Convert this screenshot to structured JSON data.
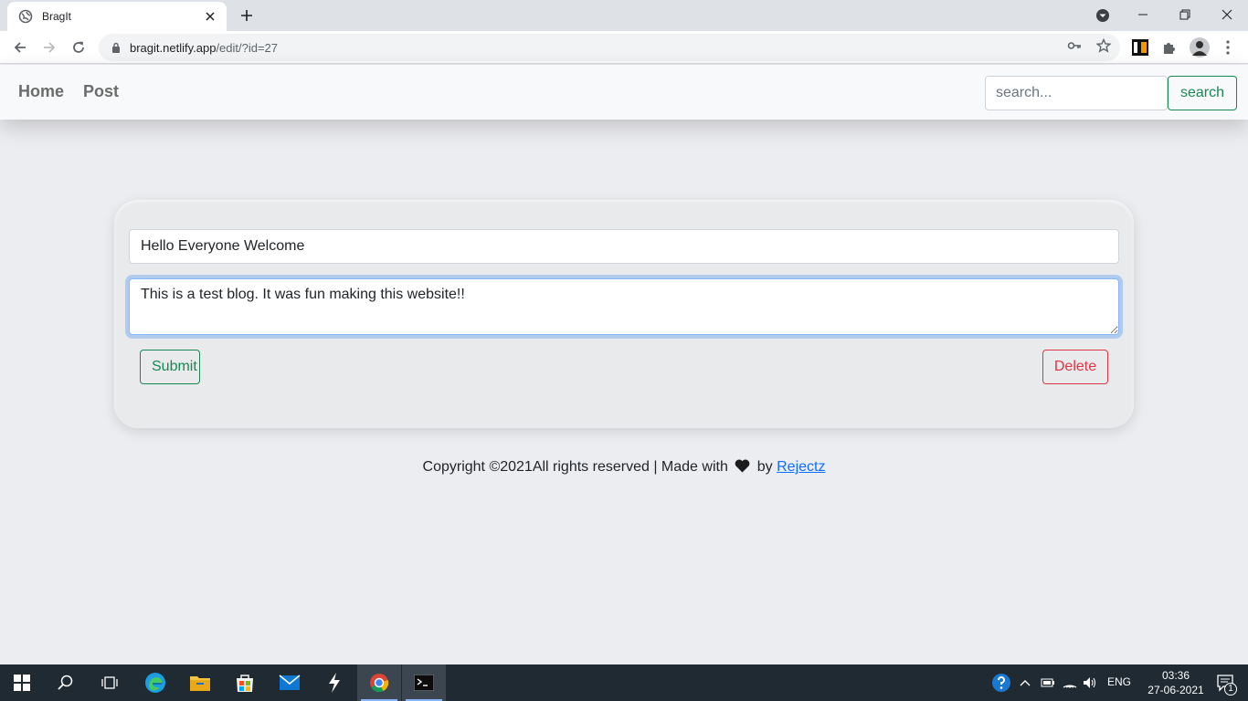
{
  "browser": {
    "tab_title": "BragIt",
    "url_host": "bragit.netlify.app",
    "url_path": "/edit/?id=27"
  },
  "navbar": {
    "home_label": "Home",
    "post_label": "Post",
    "search_placeholder": "search...",
    "search_button": "search"
  },
  "editor": {
    "title_value": "Hello Everyone Welcome",
    "body_value": "This is a test blog. It was fun making this website!!",
    "submit_label": "Submit",
    "delete_label": "Delete"
  },
  "footer": {
    "text_before": "Copyright ©2021All rights reserved | Made with",
    "text_by": "by",
    "author_link": "Rejectz"
  },
  "taskbar": {
    "language": "ENG",
    "time": "03:36",
    "date": "27-06-2021",
    "notification_count": "1"
  },
  "colors": {
    "success": "#198754",
    "danger": "#dc3545",
    "link": "#0d6efd",
    "page_bg": "#ecedf0"
  }
}
